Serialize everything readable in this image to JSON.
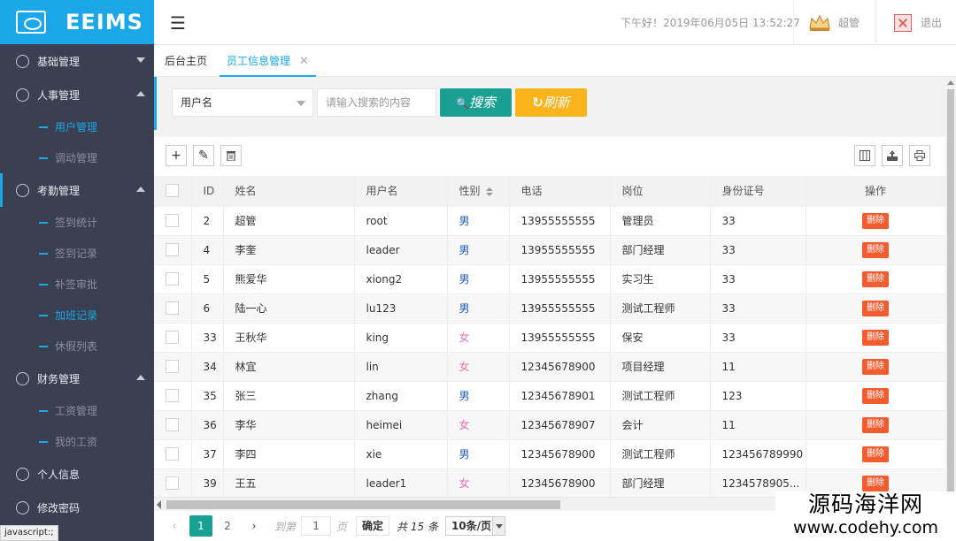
{
  "brand": {
    "title": "EEIMS"
  },
  "sidebar": {
    "groups": [
      {
        "label": "基础管理",
        "expanded": false,
        "subs": []
      },
      {
        "label": "人事管理",
        "expanded": true,
        "subs": [
          {
            "label": "用户管理",
            "active": true
          },
          {
            "label": "调动管理",
            "active": false
          }
        ]
      },
      {
        "label": "考勤管理",
        "expanded": true,
        "subs": [
          {
            "label": "签到统计",
            "active": false
          },
          {
            "label": "签到记录",
            "active": false
          },
          {
            "label": "补签审批",
            "active": false
          },
          {
            "label": "加班记录",
            "active": true
          },
          {
            "label": "休假列表",
            "active": false
          }
        ]
      },
      {
        "label": "财务管理",
        "expanded": true,
        "subs": [
          {
            "label": "工资管理",
            "active": false
          },
          {
            "label": "我的工资",
            "active": false
          }
        ]
      },
      {
        "label": "个人信息",
        "expanded": null,
        "subs": []
      },
      {
        "label": "修改密码",
        "expanded": null,
        "subs": []
      }
    ]
  },
  "header": {
    "menu_icon": "☰",
    "greeting": "下午好！2019年06月05日 13:52:27",
    "user": "超管",
    "logout": "退出"
  },
  "tabs": {
    "home": "后台主页",
    "current": "员工信息管理",
    "close": "✕"
  },
  "search": {
    "field": "用户名",
    "placeholder": "请输入搜索的内容",
    "search_label": "搜索",
    "search_icon": "🔍",
    "refresh_label": "刷新",
    "refresh_icon": "↻"
  },
  "colors": {
    "accent": "#1ba7e8",
    "green": "#1aa092",
    "orange": "#fbb31b",
    "delete": "#f25d30",
    "male": "#1a5ab8",
    "female": "#f26bb4"
  },
  "table": {
    "headers": {
      "id": "ID",
      "name": "姓名",
      "username": "用户名",
      "gender": "性别",
      "phone": "电话",
      "position": "岗位",
      "idcard": "身份证号",
      "action": "操作"
    },
    "delete_label": "删除",
    "rows": [
      {
        "id": "2",
        "name": "超管",
        "username": "root",
        "gender": "男",
        "phone": "13955555555",
        "position": "管理员",
        "idcard": "33"
      },
      {
        "id": "4",
        "name": "李奎",
        "username": "leader",
        "gender": "男",
        "phone": "13955555555",
        "position": "部门经理",
        "idcard": "33"
      },
      {
        "id": "5",
        "name": "熊爱华",
        "username": "xiong2",
        "gender": "男",
        "phone": "13955555555",
        "position": "实习生",
        "idcard": "33"
      },
      {
        "id": "6",
        "name": "陆一心",
        "username": "lu123",
        "gender": "男",
        "phone": "13955555555",
        "position": "测试工程师",
        "idcard": "33"
      },
      {
        "id": "33",
        "name": "王秋华",
        "username": "king",
        "gender": "女",
        "phone": "13955555555",
        "position": "保安",
        "idcard": "33"
      },
      {
        "id": "34",
        "name": "林宜",
        "username": "lin",
        "gender": "女",
        "phone": "12345678900",
        "position": "项目经理",
        "idcard": "11"
      },
      {
        "id": "35",
        "name": "张三",
        "username": "zhang",
        "gender": "男",
        "phone": "12345678901",
        "position": "测试工程师",
        "idcard": "123"
      },
      {
        "id": "36",
        "name": "李华",
        "username": "heimei",
        "gender": "女",
        "phone": "12345678907",
        "position": "会计",
        "idcard": "11"
      },
      {
        "id": "37",
        "name": "李四",
        "username": "xie",
        "gender": "男",
        "phone": "12345678900",
        "position": "测试工程师",
        "idcard": "123456789990"
      },
      {
        "id": "39",
        "name": "王五",
        "username": "leader1",
        "gender": "女",
        "phone": "12345678900",
        "position": "部门经理",
        "idcard": "1234578905..."
      }
    ]
  },
  "pager": {
    "pages": [
      "1",
      "2"
    ],
    "current": "1",
    "goto_label": "到第",
    "goto_value": "1",
    "page_label": "页",
    "confirm": "确定",
    "total": "共 15 条",
    "page_size": "10条/页"
  },
  "status_url": "javascript:;",
  "watermark": {
    "line1": "源码海洋网",
    "line2": "www.codehy.com"
  }
}
